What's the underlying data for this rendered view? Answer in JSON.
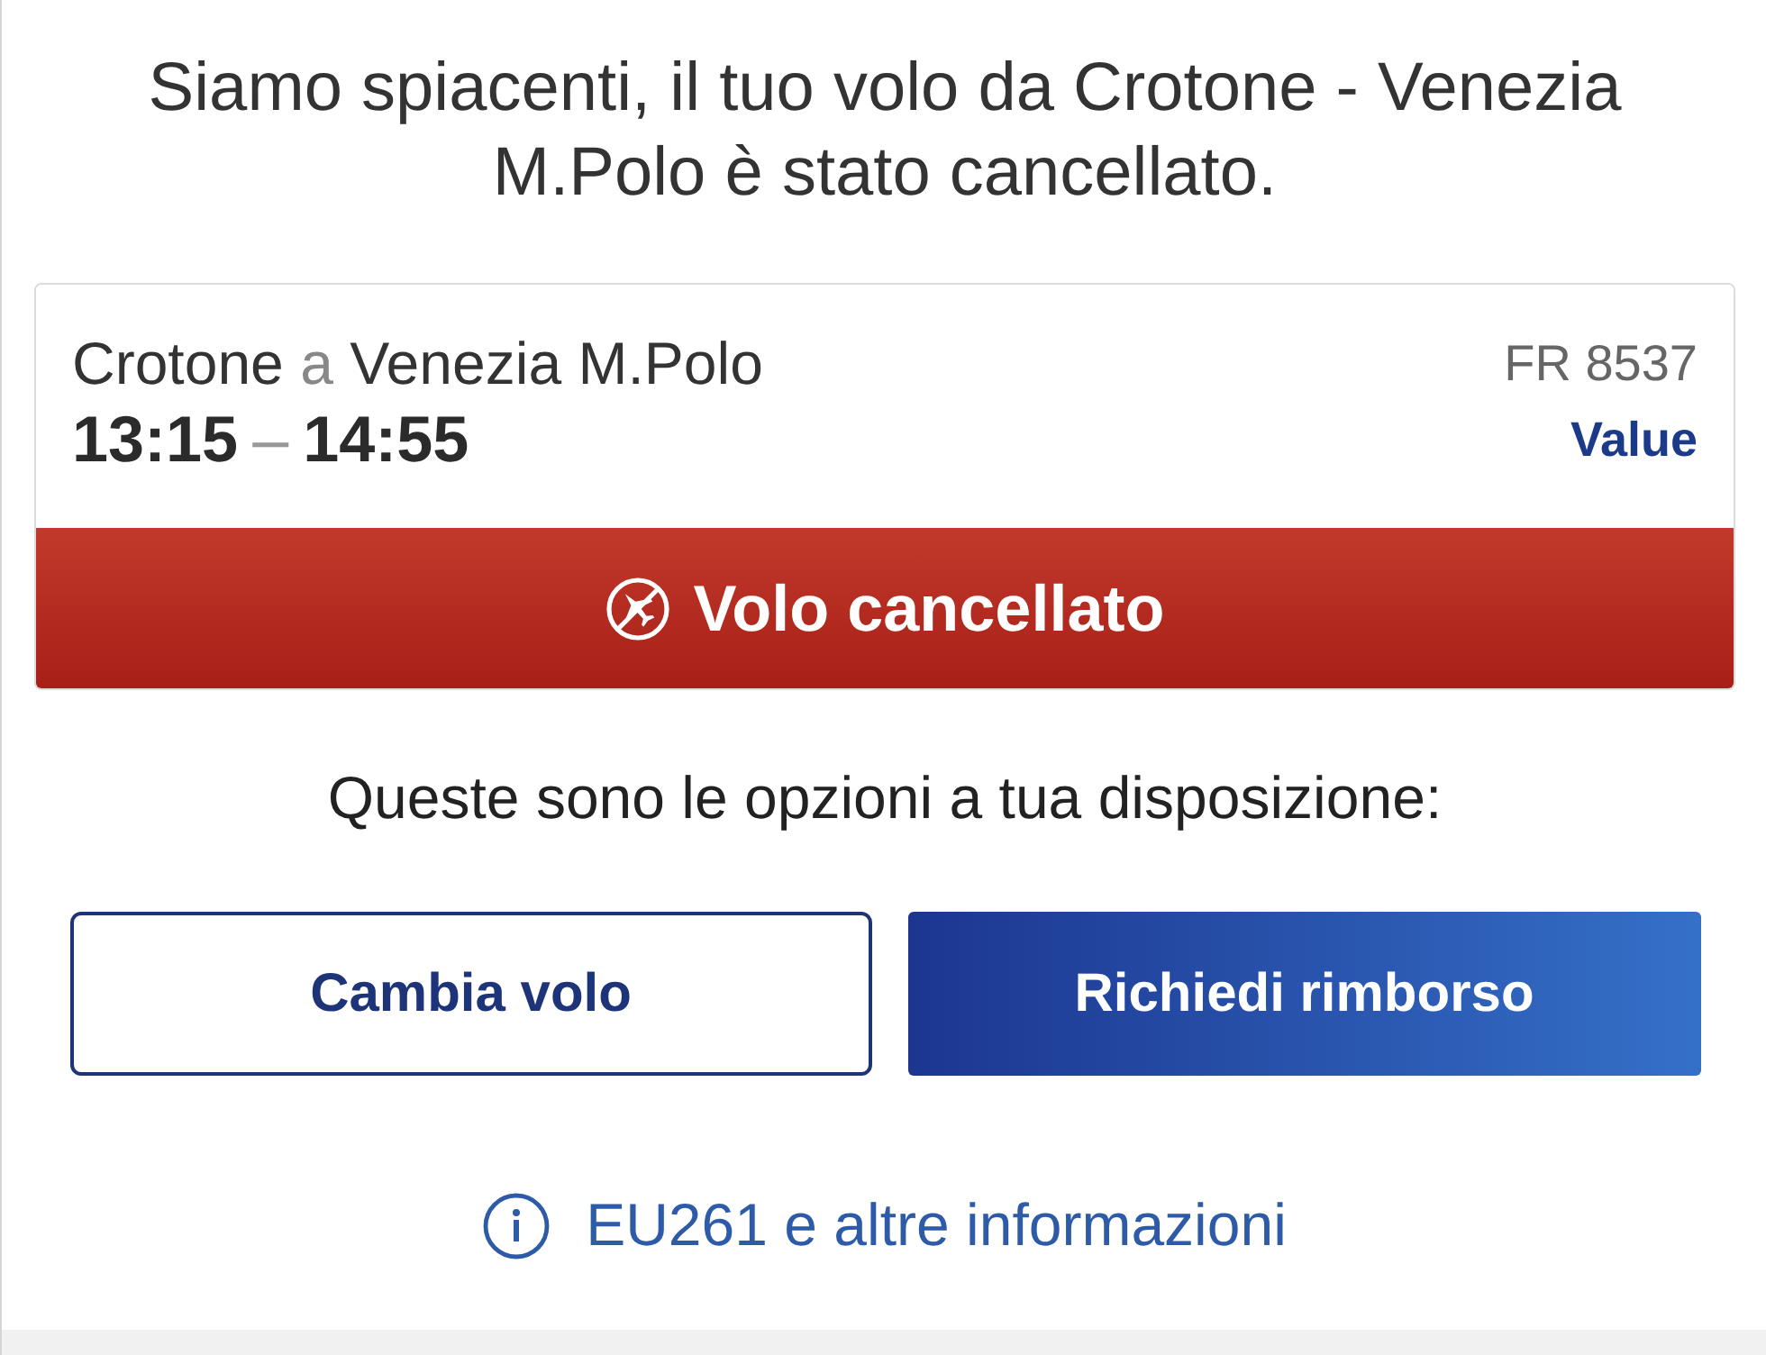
{
  "heading": "Siamo spiacenti, il tuo volo da Crotone - Venezia M.Polo è stato cancellato.",
  "flight": {
    "origin": "Crotone",
    "connector": "a",
    "destination": "Venezia M.Polo",
    "departure": "13:15",
    "separator": "–",
    "arrival": "14:55",
    "flight_number": "FR 8537",
    "fare": "Value",
    "status": {
      "kind": "cancelled",
      "label": "Volo cancellato"
    }
  },
  "options_heading": "Queste sono le opzioni a tua disposizione:",
  "buttons": [
    {
      "label": "Cambia volo",
      "kind": "secondary"
    },
    {
      "label": "Richiedi rimborso",
      "kind": "primary"
    }
  ],
  "info_link": "EU261 e altre informazioni"
}
